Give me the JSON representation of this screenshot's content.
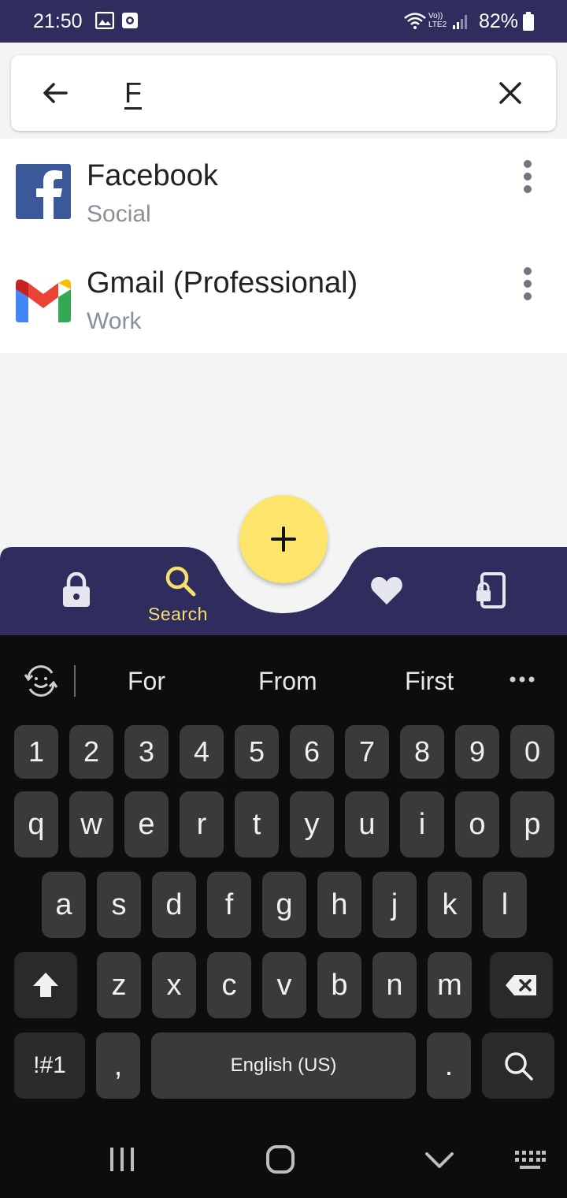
{
  "status_bar": {
    "time": "21:50",
    "network_label": "Vo)) LTE2",
    "battery": "82%"
  },
  "search": {
    "query": "F",
    "back_icon": "arrow-left-icon",
    "clear_icon": "close-icon"
  },
  "results": [
    {
      "title": "Facebook",
      "category": "Social",
      "icon": "facebook-logo-icon"
    },
    {
      "title": "Gmail (Professional)",
      "category": "Work",
      "icon": "gmail-logo-icon"
    }
  ],
  "bottom_nav": {
    "items": [
      {
        "icon": "lock-icon",
        "label": ""
      },
      {
        "icon": "search-icon",
        "label": "Search",
        "active": true
      },
      {
        "icon": "heart-icon",
        "label": ""
      },
      {
        "icon": "device-lock-icon",
        "label": ""
      }
    ],
    "fab_icon": "plus-icon",
    "active_color": "#f7df6e",
    "bar_color": "#2f2c5e"
  },
  "keyboard": {
    "suggestions": [
      "For",
      "From",
      "First"
    ],
    "number_row": [
      "1",
      "2",
      "3",
      "4",
      "5",
      "6",
      "7",
      "8",
      "9",
      "0"
    ],
    "row1": [
      "q",
      "w",
      "e",
      "r",
      "t",
      "y",
      "u",
      "i",
      "o",
      "p"
    ],
    "row2": [
      "a",
      "s",
      "d",
      "f",
      "g",
      "h",
      "j",
      "k",
      "l"
    ],
    "row3": [
      "z",
      "x",
      "c",
      "v",
      "b",
      "n",
      "m"
    ],
    "symbols_key": "!#1",
    "comma_key": ",",
    "space_label": "English (US)",
    "period_key": "."
  },
  "colors": {
    "fab": "#fde46a",
    "header": "#2f2c5e",
    "keyboard_bg": "#0d0d0d",
    "key_bg": "#3a3a3c"
  }
}
